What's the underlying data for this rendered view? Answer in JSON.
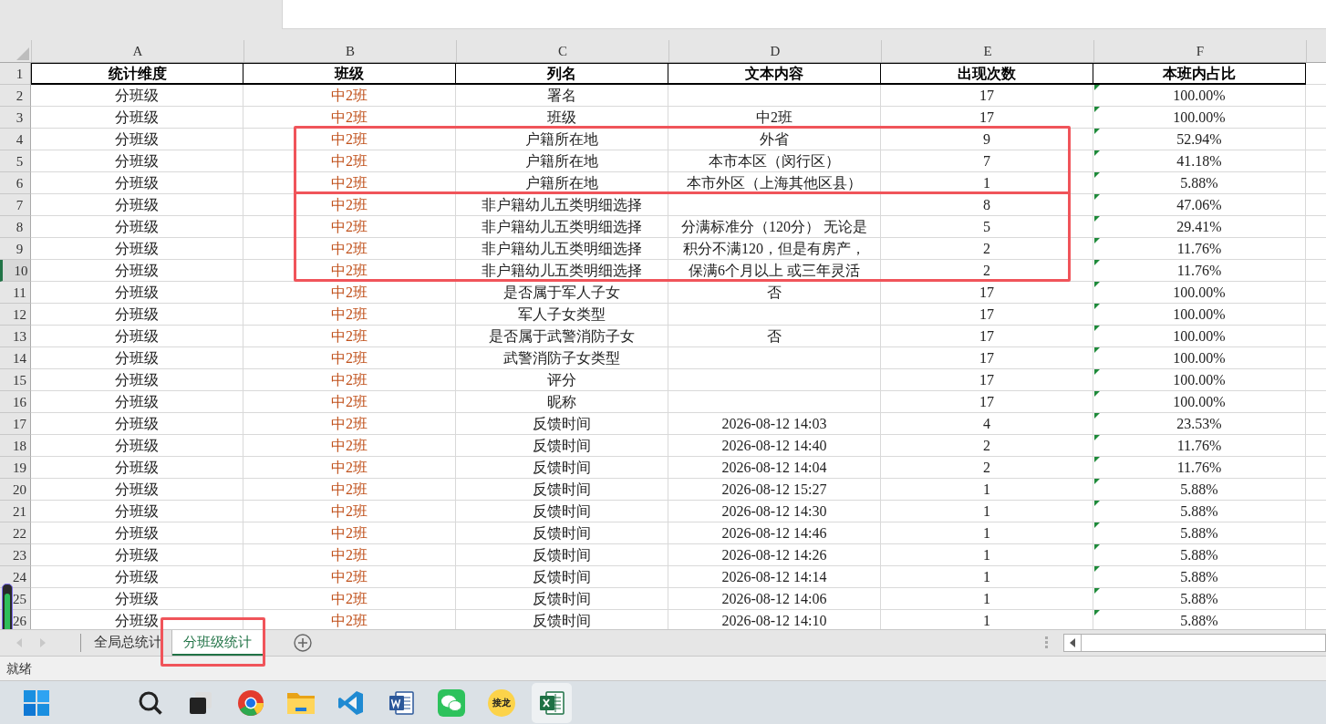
{
  "columns": [
    "A",
    "B",
    "C",
    "D",
    "E",
    "F"
  ],
  "rows": [
    {
      "num": "1",
      "header": true,
      "cells": [
        "统计维度",
        "班级",
        "列名",
        "文本内容",
        "出现次数",
        "本班内占比"
      ]
    },
    {
      "num": "2",
      "flag": true,
      "cells": [
        "分班级",
        "中2班",
        "署名",
        "",
        "17",
        "100.00%"
      ]
    },
    {
      "num": "3",
      "flag": true,
      "cells": [
        "分班级",
        "中2班",
        "班级",
        "中2班",
        "17",
        "100.00%"
      ]
    },
    {
      "num": "4",
      "flag": true,
      "box_start": true,
      "cells": [
        "分班级",
        "中2班",
        "户籍所在地",
        "外省",
        "9",
        "52.94%"
      ]
    },
    {
      "num": "5",
      "flag": true,
      "cells": [
        "分班级",
        "中2班",
        "户籍所在地",
        "本市本区（闵行区）",
        "7",
        "41.18%"
      ]
    },
    {
      "num": "6",
      "flag": true,
      "box_end": true,
      "cells": [
        "分班级",
        "中2班",
        "户籍所在地",
        "本市外区（上海其他区县）",
        "1",
        "5.88%"
      ]
    },
    {
      "num": "7",
      "flag": true,
      "box_start": true,
      "cells": [
        "分班级",
        "中2班",
        "非户籍幼儿五类明细选择",
        "",
        "8",
        "47.06%"
      ]
    },
    {
      "num": "8",
      "flag": true,
      "cells": [
        "分班级",
        "中2班",
        "非户籍幼儿五类明细选择",
        "分满标准分（120分） 无论是",
        "5",
        "29.41%"
      ]
    },
    {
      "num": "9",
      "flag": true,
      "cells": [
        "分班级",
        "中2班",
        "非户籍幼儿五类明细选择",
        "积分不满120，但是有房产，",
        "2",
        "11.76%"
      ]
    },
    {
      "num": "10",
      "flag": true,
      "selected": true,
      "box_end": true,
      "cells": [
        "分班级",
        "中2班",
        "非户籍幼儿五类明细选择",
        "保满6个月以上 或三年灵活",
        "2",
        "11.76%"
      ]
    },
    {
      "num": "11",
      "flag": true,
      "cells": [
        "分班级",
        "中2班",
        "是否属于军人子女",
        "否",
        "17",
        "100.00%"
      ]
    },
    {
      "num": "12",
      "flag": true,
      "cells": [
        "分班级",
        "中2班",
        "军人子女类型",
        "",
        "17",
        "100.00%"
      ]
    },
    {
      "num": "13",
      "flag": true,
      "cells": [
        "分班级",
        "中2班",
        "是否属于武警消防子女",
        "否",
        "17",
        "100.00%"
      ]
    },
    {
      "num": "14",
      "flag": true,
      "cells": [
        "分班级",
        "中2班",
        "武警消防子女类型",
        "",
        "17",
        "100.00%"
      ]
    },
    {
      "num": "15",
      "flag": true,
      "cells": [
        "分班级",
        "中2班",
        "评分",
        "",
        "17",
        "100.00%"
      ]
    },
    {
      "num": "16",
      "flag": true,
      "cells": [
        "分班级",
        "中2班",
        "昵称",
        "",
        "17",
        "100.00%"
      ]
    },
    {
      "num": "17",
      "flag": true,
      "cells": [
        "分班级",
        "中2班",
        "反馈时间",
        "2026-08-12 14:03",
        "4",
        "23.53%"
      ]
    },
    {
      "num": "18",
      "flag": true,
      "cells": [
        "分班级",
        "中2班",
        "反馈时间",
        "2026-08-12 14:40",
        "2",
        "11.76%"
      ]
    },
    {
      "num": "19",
      "flag": true,
      "cells": [
        "分班级",
        "中2班",
        "反馈时间",
        "2026-08-12 14:04",
        "2",
        "11.76%"
      ]
    },
    {
      "num": "20",
      "flag": true,
      "cells": [
        "分班级",
        "中2班",
        "反馈时间",
        "2026-08-12 15:27",
        "1",
        "5.88%"
      ]
    },
    {
      "num": "21",
      "flag": true,
      "cells": [
        "分班级",
        "中2班",
        "反馈时间",
        "2026-08-12 14:30",
        "1",
        "5.88%"
      ]
    },
    {
      "num": "22",
      "flag": true,
      "cells": [
        "分班级",
        "中2班",
        "反馈时间",
        "2026-08-12 14:46",
        "1",
        "5.88%"
      ]
    },
    {
      "num": "23",
      "flag": true,
      "cells": [
        "分班级",
        "中2班",
        "反馈时间",
        "2026-08-12 14:26",
        "1",
        "5.88%"
      ]
    },
    {
      "num": "24",
      "flag": true,
      "cells": [
        "分班级",
        "中2班",
        "反馈时间",
        "2026-08-12 14:14",
        "1",
        "5.88%"
      ]
    },
    {
      "num": "25",
      "flag": true,
      "cells": [
        "分班级",
        "中2班",
        "反馈时间",
        "2026-08-12 14:06",
        "1",
        "5.88%"
      ]
    },
    {
      "num": "26",
      "flag": true,
      "cells": [
        "分班级",
        "中2班",
        "反馈时间",
        "2026-08-12 14:10",
        "1",
        "5.88%"
      ]
    }
  ],
  "sheet_tabs": [
    {
      "label": "全局总统计",
      "selected": false,
      "annotated": false
    },
    {
      "label": "分班级统计",
      "selected": true,
      "annotated": true
    }
  ],
  "status_bar": {
    "text": "就绪"
  },
  "taskbar": [
    {
      "kind": "start",
      "active": false
    },
    {
      "kind": "search",
      "active": false
    },
    {
      "kind": "taskview",
      "active": false
    },
    {
      "kind": "chrome",
      "active": false
    },
    {
      "kind": "folder",
      "active": false
    },
    {
      "kind": "vscode",
      "active": false
    },
    {
      "kind": "word",
      "active": false
    },
    {
      "kind": "wechat",
      "active": false
    },
    {
      "kind": "text",
      "label": "接龙",
      "active": false
    },
    {
      "kind": "excel",
      "active": true
    }
  ]
}
